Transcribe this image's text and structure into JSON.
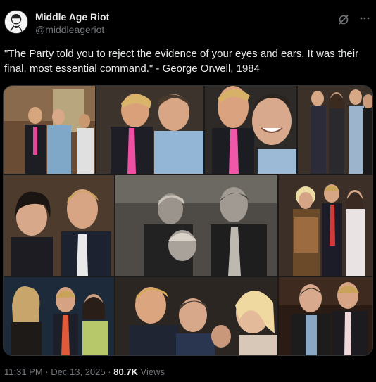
{
  "author": {
    "display_name": "Middle Age Riot",
    "handle": "@middleageriot"
  },
  "post": {
    "text": "\"The Party told you to reject the evidence of your eyes and ears. It was their final, most essential command.\" - George Orwell, 1984"
  },
  "meta": {
    "time": "11:31 PM",
    "separator": "·",
    "date": "Dec 13, 2025",
    "views_count": "80.7K",
    "views_label": "Views"
  },
  "icons": {
    "grok": "grok-slash-icon",
    "more": "more-dots-icon"
  },
  "colors": {
    "background": "#000000",
    "text_primary": "#e7e9ea",
    "text_secondary": "#71767b",
    "border": "#2f3336"
  }
}
